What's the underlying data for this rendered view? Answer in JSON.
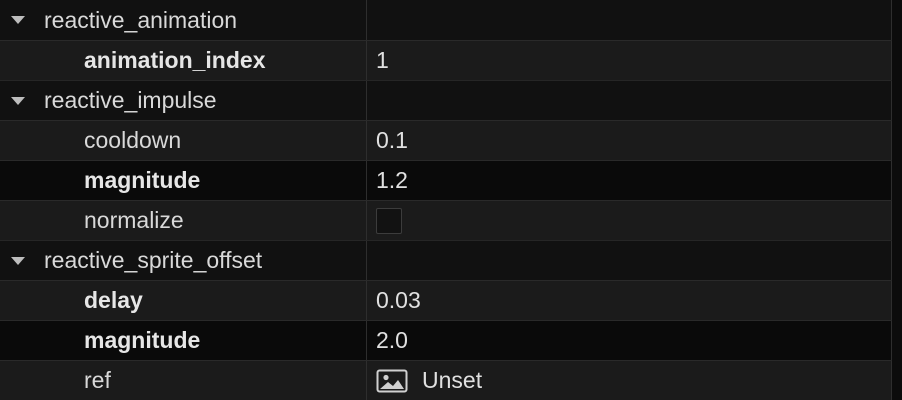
{
  "sections": [
    {
      "name": "reactive_animation",
      "props": [
        {
          "name": "animation_index",
          "value": "1",
          "bold": true
        }
      ]
    },
    {
      "name": "reactive_impulse",
      "props": [
        {
          "name": "cooldown",
          "value": "0.1",
          "bold": false
        },
        {
          "name": "magnitude",
          "value": "1.2",
          "bold": true
        },
        {
          "name": "normalize",
          "value": "",
          "type": "checkbox",
          "checked": false,
          "bold": false
        }
      ]
    },
    {
      "name": "reactive_sprite_offset",
      "props": [
        {
          "name": "delay",
          "value": "0.03",
          "bold": true
        },
        {
          "name": "magnitude",
          "value": "2.0",
          "bold": true
        },
        {
          "name": "ref",
          "value": "Unset",
          "type": "resource",
          "icon": "image-icon",
          "bold": false
        }
      ]
    }
  ],
  "colors": {
    "background": "#0c0c0c",
    "row_alt": "#1b1b1b",
    "text": "#d9d9d9",
    "caret": "#bdbdbd"
  }
}
